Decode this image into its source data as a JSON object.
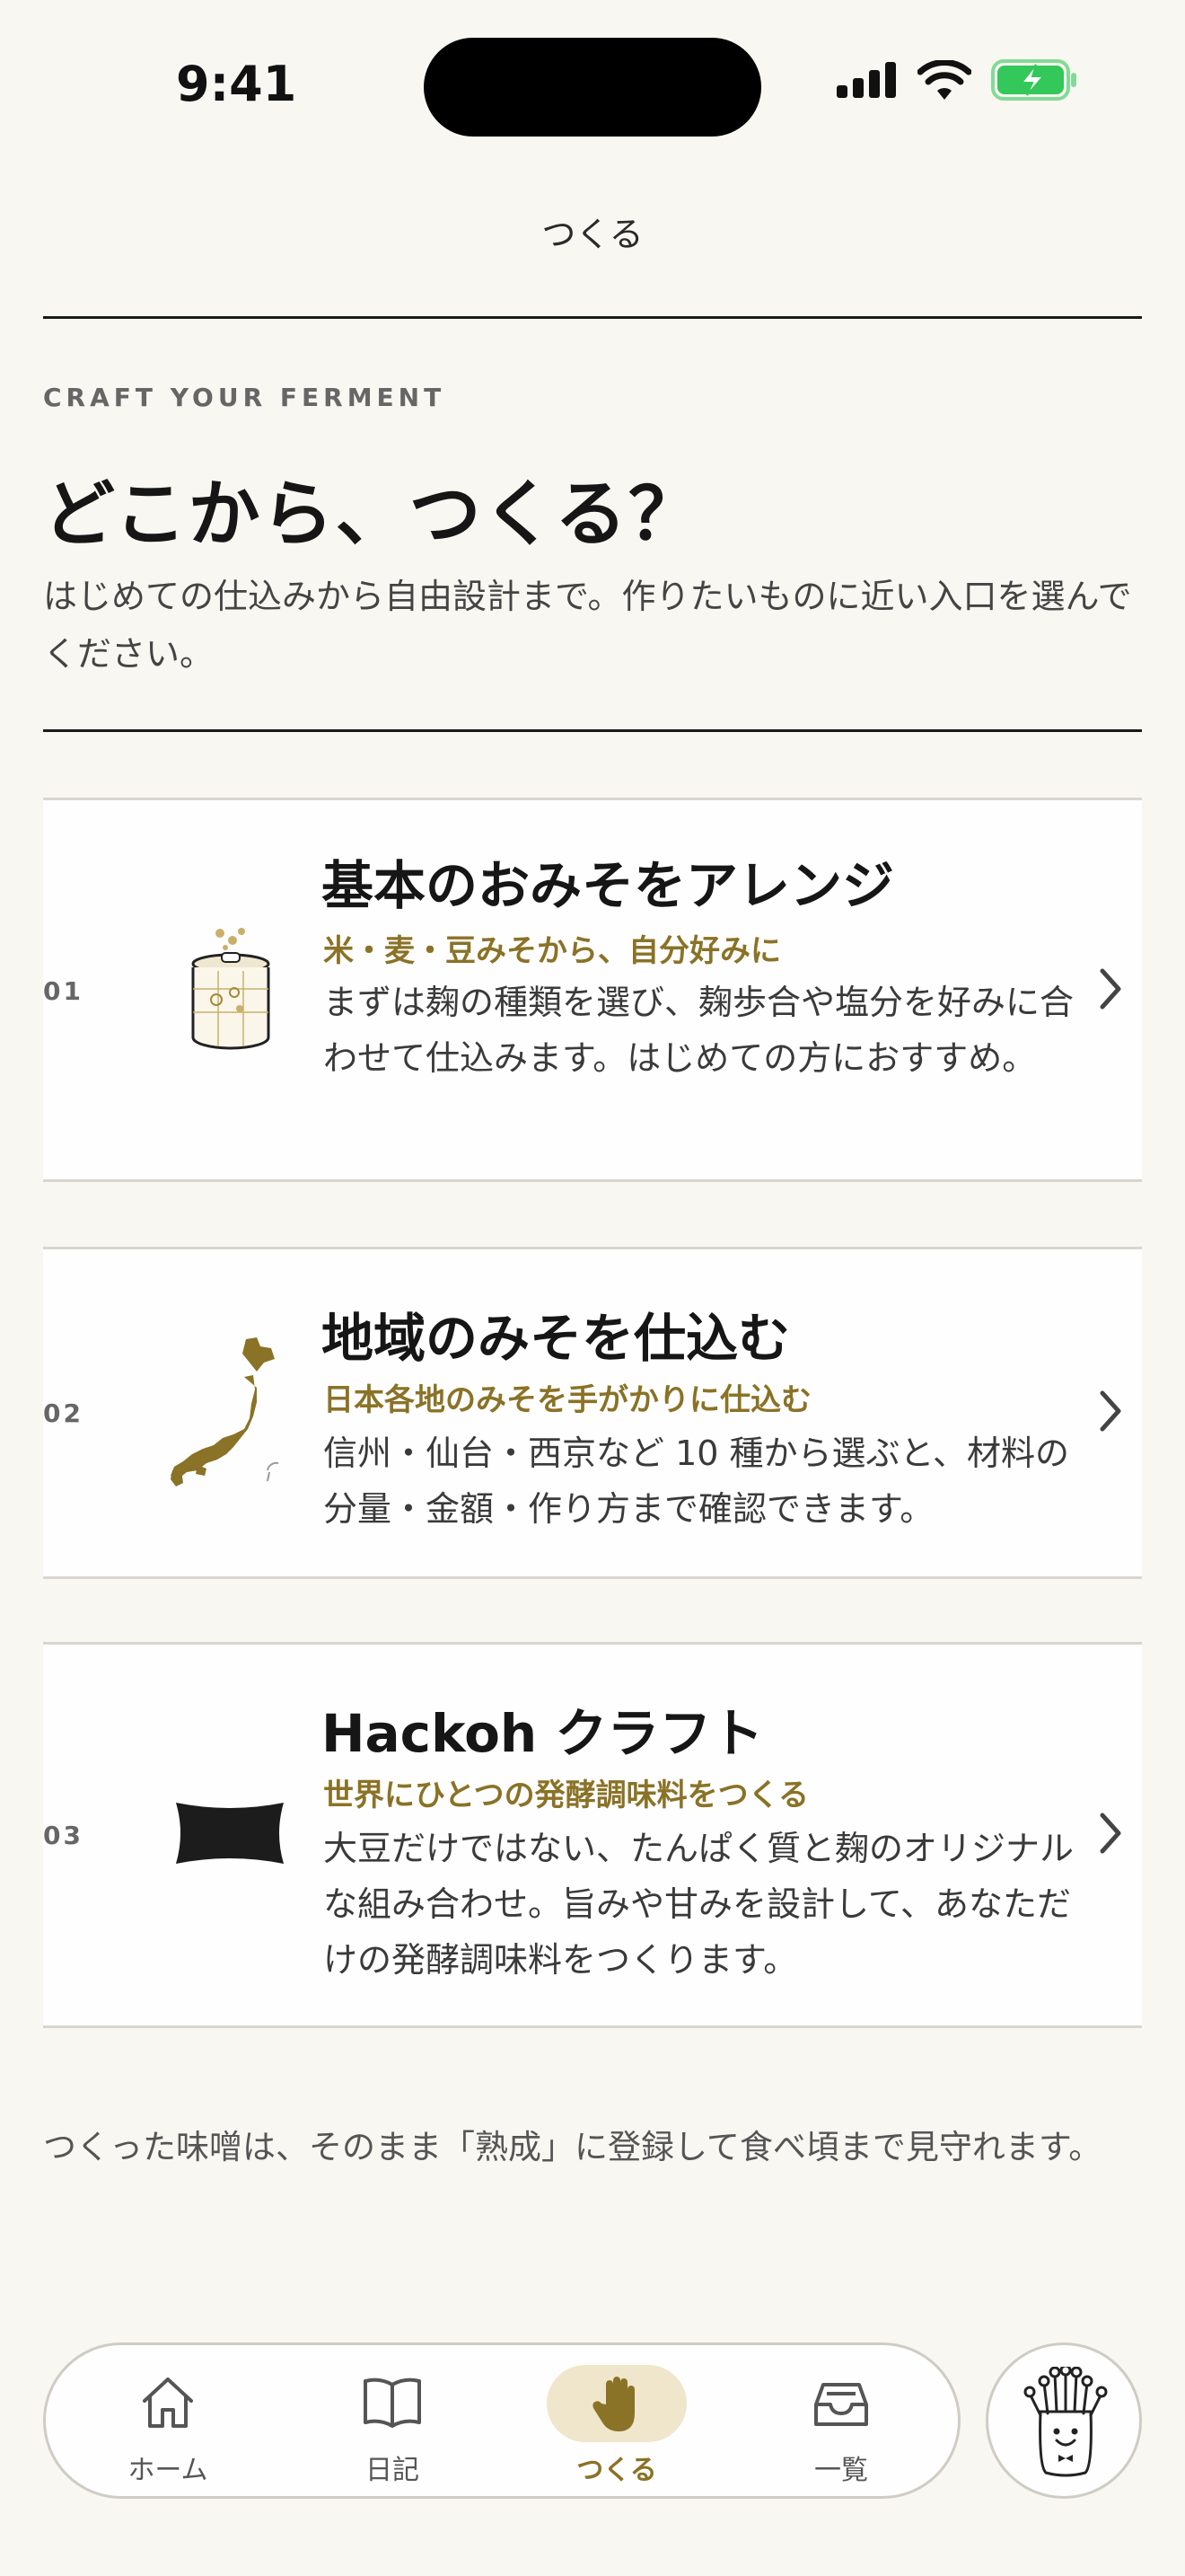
{
  "status_bar": {
    "time": "9:41"
  },
  "nav": {
    "title": "つくる"
  },
  "header": {
    "eyebrow": "CRAFT YOUR FERMENT",
    "headline": "どこから、つくる？",
    "intro": "はじめての仕込みから自由設計まで。作りたいものに近い入口を選んでください。"
  },
  "cards": [
    {
      "number": "01",
      "icon": "miso-jar-icon",
      "title": "基本のおみそをアレンジ",
      "subtitle": "米・麦・豆みそから、自分好みに",
      "description": "まずは麹の種類を選び、麹歩合や塩分を好みに合わせて仕込みます。はじめての方におすすめ。"
    },
    {
      "number": "02",
      "icon": "japan-map-icon",
      "title": "地域のみそを仕込む",
      "subtitle": "日本各地のみそを手がかりに仕込む",
      "description": "信州・仙台・西京など 10 種から選ぶと、材料の分量・金額・作り方まで確認できます。"
    },
    {
      "number": "03",
      "icon": "hackoh-shape-icon",
      "title": "Hackoh クラフト",
      "subtitle": "世界にひとつの発酵調味料をつくる",
      "description": "大豆だけではない、たんぱく質と麹のオリジナルな組み合わせ。旨みや甘みを設計して、あなただけの発酵調味料をつくります。"
    }
  ],
  "footnote": "つくった味噌は、そのまま「熟成」に登録して食べ頃まで見守れます。",
  "tabbar": {
    "tabs": [
      {
        "label": "ホーム",
        "icon": "home-icon"
      },
      {
        "label": "日記",
        "icon": "book-icon"
      },
      {
        "label": "つくる",
        "icon": "hand-icon",
        "active": true
      },
      {
        "label": "一覧",
        "icon": "inbox-icon"
      }
    ],
    "mascot": "mascot-icon"
  },
  "colors": {
    "accent": "#8a7226",
    "background": "#f9f7f2",
    "active_pill": "#f0e6cc",
    "battery": "#34c759"
  }
}
